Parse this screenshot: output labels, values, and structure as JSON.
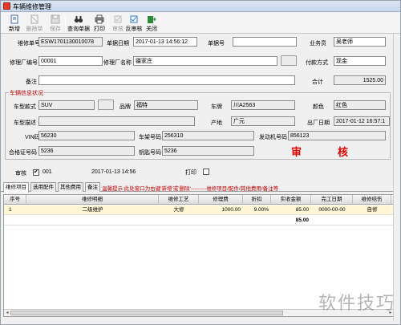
{
  "window": {
    "title": "车辆维修管理"
  },
  "toolbar": {
    "new": "新增",
    "del_row": "删除单",
    "save": "保存",
    "query": "查询单据",
    "print": "打印",
    "audit": "审核",
    "unaudit": "反审核",
    "close": "关闭"
  },
  "form": {
    "repair_no_label": "维修单号",
    "repair_no": "ESW1701130010078",
    "doc_date_label": "单据日期",
    "doc_date": "2017-01-13 14:56:12",
    "order_no_label": "单据号",
    "order_no": "",
    "salesman_label": "业务员",
    "salesman": "吴老师",
    "factory_no_label": "修理厂编号",
    "factory_no": "00001",
    "factory_name_label": "修理厂名称",
    "factory_name": "疆家庄",
    "pay_label": "付款方式",
    "pay": "现金",
    "remark_label": "备注",
    "remark": "",
    "total_label": "合计",
    "total": "1525.00"
  },
  "vehicle": {
    "group_title": "车辆信息状况",
    "model_label": "车型款式",
    "model": "SUV",
    "brand_label": "品牌",
    "brand": "福特",
    "plate_label": "车牌",
    "plate": "川A2563",
    "color_label": "颜色",
    "color": "红色",
    "desc_label": "车型描述",
    "desc": "",
    "origin_label": "产地",
    "origin": "广元",
    "factory_date_label": "出厂日期",
    "factory_date": "2017-01-12 16:57:1",
    "vin_label": "VIN码",
    "vin": "56230",
    "frame_label": "车架号码",
    "frame": "256310",
    "engine_label": "发动机号码",
    "engine": "856123",
    "cert_label": "合格证号码",
    "cert": "5236",
    "key_label": "钥匙号码",
    "key": "5236",
    "audit_stamp_1": "审",
    "audit_stamp_2": "核"
  },
  "auditor": {
    "label": "审核",
    "value": "001",
    "date": "2017-01-13 14:56",
    "print_label": "打印"
  },
  "tabs": [
    "维修项目",
    "选用配件",
    "其他费用",
    "备注"
  ],
  "hint": "温馨提示:此处窗口为右键'新增'或'删除'---------维修项目/配件/其他费用/备注等",
  "table": {
    "columns": [
      "序号",
      "维修明细",
      "维修工艺",
      "修理费",
      "折扣",
      "实收金额",
      "完工日期",
      "维修结伤"
    ],
    "rows": [
      [
        "1",
        "二级维护",
        "大修",
        "1000.00",
        "9.00%",
        "85.00",
        "0000-00-00",
        "自修"
      ]
    ],
    "sum": "85.00"
  },
  "watermark": "软件技巧"
}
